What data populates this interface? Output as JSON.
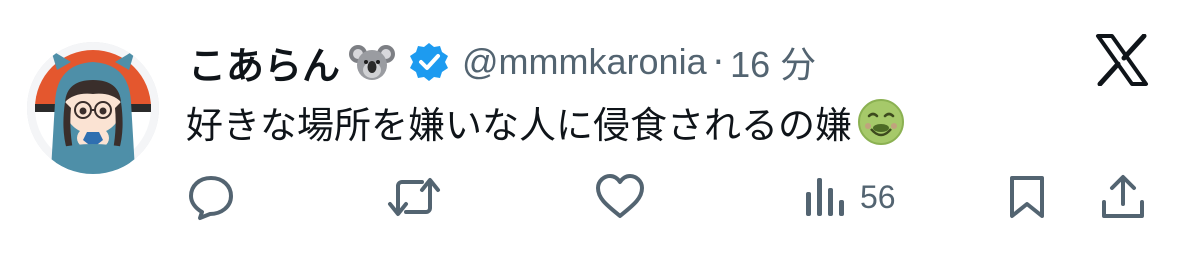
{
  "tweet": {
    "display_name": "こあらん",
    "name_emoji": "koala-emoji",
    "verified": true,
    "handle": "@mmmkaronia",
    "separator": "·",
    "time": "16 分",
    "text": "好きな場所を嫌いな人に侵食されるの嫌",
    "text_emoji": "nauseated-face-emoji"
  },
  "brand": {
    "logo": "x-logo-icon",
    "verified_color": "#1d9bf0"
  },
  "actions": {
    "reply_icon": "reply-icon",
    "retweet_icon": "retweet-icon",
    "like_icon": "heart-icon",
    "views_icon": "views-icon",
    "views_count": "56",
    "bookmark_icon": "bookmark-icon",
    "share_icon": "share-icon",
    "icon_color": "#536471"
  }
}
